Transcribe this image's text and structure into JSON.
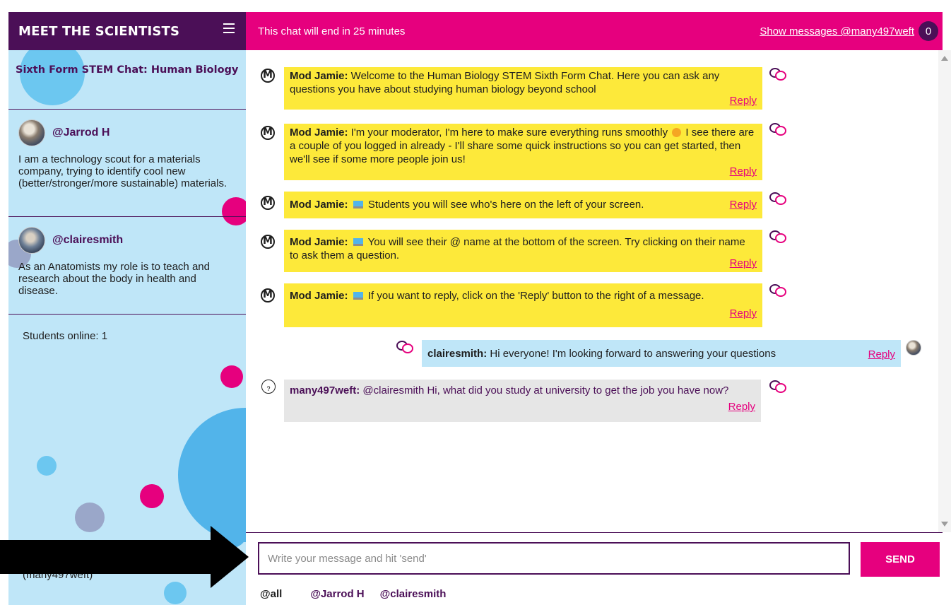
{
  "brand": "MEET THE SCIENTISTS",
  "sidebar": {
    "chat_title": "Sixth Form STEM Chat: Human Biology",
    "scientists": [
      {
        "name": "@Jarrod H",
        "bio": "I am a technology scout for a materials company, trying to identify cool new (better/stronger/more sustainable) materials."
      },
      {
        "name": "@clairesmith",
        "bio": "As an Anatomists my role is to teach and research about the body in health and disease."
      }
    ],
    "students_online": "Students online: 1",
    "current_user": "(many497weft)"
  },
  "topbar": {
    "timer": "This chat will end in 25 minutes",
    "show_messages": "Show messages @many497weft",
    "count": "0"
  },
  "messages": [
    {
      "author": "Mod Jamie:",
      "text": " Welcome to the Human Biology STEM Sixth Form Chat. Here you can ask any questions you have about studying human biology beyond school",
      "reply": "Reply"
    },
    {
      "author": "Mod Jamie:",
      "text_a": " I'm your moderator, I'm here to make sure everything runs smoothly ",
      "text_b": " I see there are a couple of you logged in already - I'll share some quick instructions so you can get started, then we'll see if some more people join us!",
      "reply": "Reply"
    },
    {
      "author": "Mod Jamie:",
      "text": " Students you will see who's here on the left of your screen.",
      "reply": "Reply"
    },
    {
      "author": "Mod Jamie:",
      "text": " You will see their @ name at the bottom of the screen. Try clicking on their name to ask them a question.",
      "reply": "Reply"
    },
    {
      "author": "Mod Jamie:",
      "text": " If you want to reply, click on the 'Reply' button to the right of a message.",
      "reply": "Reply"
    },
    {
      "author": "clairesmith:",
      "text": " Hi everyone! I'm looking forward to answering your questions",
      "reply": "Reply"
    },
    {
      "author": "many497weft:",
      "text": " @clairesmith Hi, what did you study at university to get the job you have now?",
      "reply": "Reply"
    }
  ],
  "composer": {
    "placeholder": "Write your message and hit 'send'",
    "send_label": "SEND",
    "mentions": [
      "@all",
      "@Jarrod H",
      "@clairesmith"
    ]
  },
  "colors": {
    "purple": "#4b0f57",
    "magenta": "#e6007e",
    "light_blue": "#bfe6f8",
    "mod_yellow": "#fde93a",
    "student_grey": "#e6e6e6"
  }
}
